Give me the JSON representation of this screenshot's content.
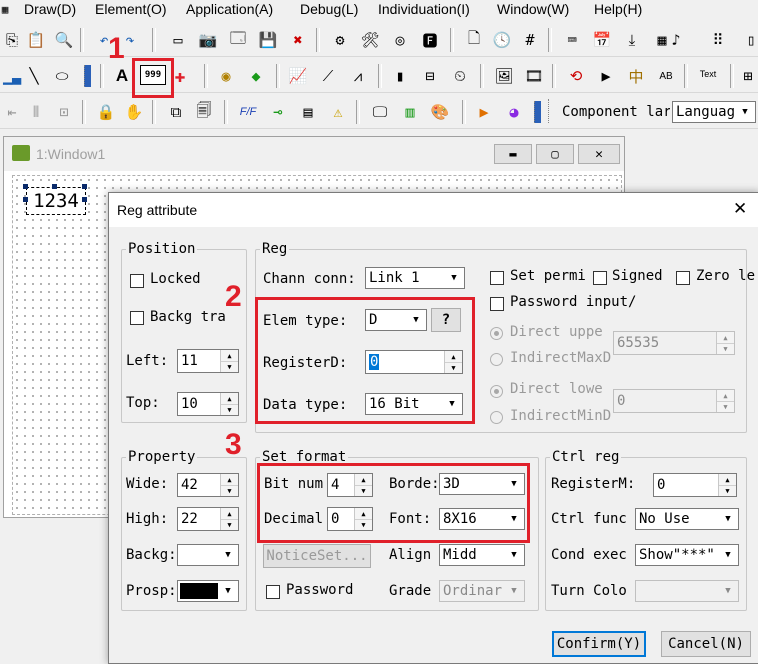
{
  "menu": [
    "Draw(D)",
    "Element(O)",
    "Application(A)",
    "Debug(L)",
    "Individuation(I)",
    "Window(W)",
    "Help(H)"
  ],
  "toolbar": {
    "text_tool_label": "A",
    "numeric_tool_label": "999",
    "component_label": "Component lar",
    "language_value": "Languag",
    "text_button_label": "Text"
  },
  "colors": {
    "annotation_red": "#e0202a",
    "highlight_blue": "#0078d7"
  },
  "inner_window": {
    "title": "1:Window1",
    "numeric_element_text": "1234"
  },
  "dialog": {
    "title": "Reg attribute",
    "close_glyph": "✕",
    "position": {
      "legend": "Position",
      "locked_label": "Locked",
      "backg_label": "Backg tra",
      "left_label": "Left:",
      "left_value": "11",
      "top_label": "Top:",
      "top_value": "10"
    },
    "reg": {
      "legend": "Reg",
      "chann_label": "Chann conn:",
      "chann_value": "Link 1",
      "elem_type_label": "Elem type:",
      "elem_type_value": "D",
      "help_label": "?",
      "register_label": "RegisterD:",
      "register_value": "0",
      "data_type_label": "Data type:",
      "data_type_value": "16 Bit",
      "set_permi_label": "Set permi",
      "signed_label": "Signed",
      "zero_label": "Zero le",
      "password_input_label": "Password input/",
      "direct_upper_label": "Direct uppe",
      "indirect_max_label": "IndirectMaxD",
      "max_value": "65535",
      "direct_lower_label": "Direct lowe",
      "indirect_min_label": "IndirectMinD",
      "min_value": "0"
    },
    "property": {
      "legend": "Property",
      "wide_label": "Wide:",
      "wide_value": "42",
      "high_label": "High:",
      "high_value": "22",
      "backg_label": "Backg:",
      "prosp_label": "Prosp:"
    },
    "set_format": {
      "legend": "Set format",
      "bit_num_label": "Bit num",
      "bit_num_value": "4",
      "decimal_label": "Decimal",
      "decimal_value": "0",
      "border_label": "Borde:",
      "border_value": "3D",
      "font_label": "Font:",
      "font_value": "8X16",
      "notice_label": "NoticeSet...",
      "align_label": "Align",
      "align_value": "Midd",
      "password_label": "Password",
      "grade_label": "Grade",
      "grade_value": "Ordinar"
    },
    "ctrl_reg": {
      "legend": "Ctrl reg",
      "register_label": "RegisterM:",
      "register_value": "0",
      "ctrl_func_label": "Ctrl func",
      "ctrl_func_value": "No Use",
      "cond_exec_label": "Cond exec",
      "cond_exec_value": "Show\"***\"",
      "turn_color_label": "Turn Colo"
    },
    "confirm_label": "Confirm(Y)",
    "cancel_label": "Cancel(N)"
  },
  "annotations": [
    "1",
    "2",
    "3"
  ]
}
